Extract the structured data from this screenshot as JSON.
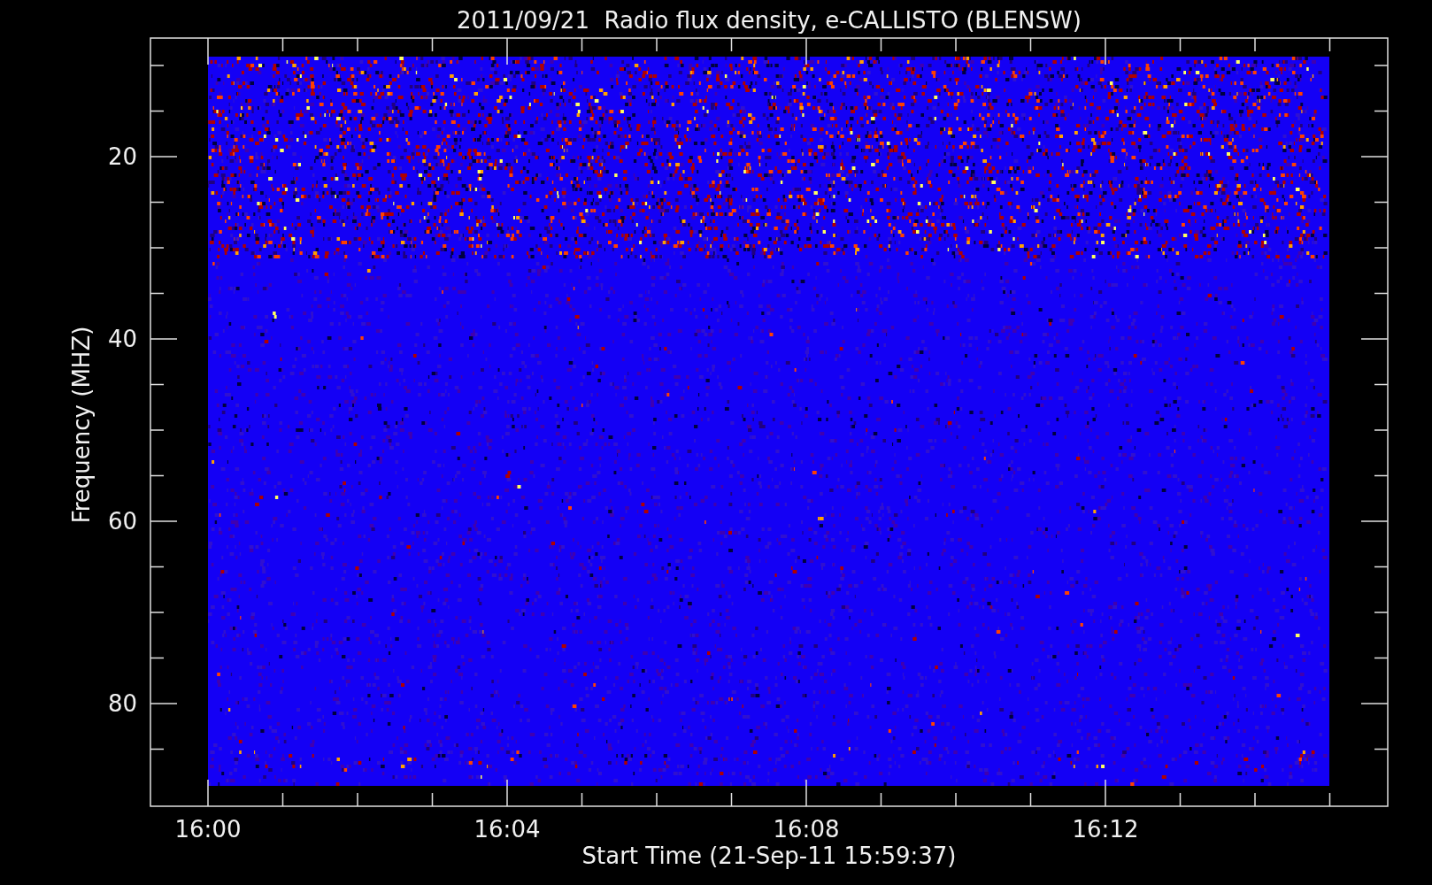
{
  "title": "2011/09/21  Radio flux density, e-CALLISTO (BLENSW)",
  "y_axis": {
    "label": "Frequency (MHZ)",
    "ticks": [
      "20",
      "40",
      "60",
      "80"
    ]
  },
  "x_axis": {
    "label": "Start Time (21-Sep-11 15:59:37)",
    "ticks": [
      "16:00",
      "16:04",
      "16:08",
      "16:12"
    ]
  }
}
